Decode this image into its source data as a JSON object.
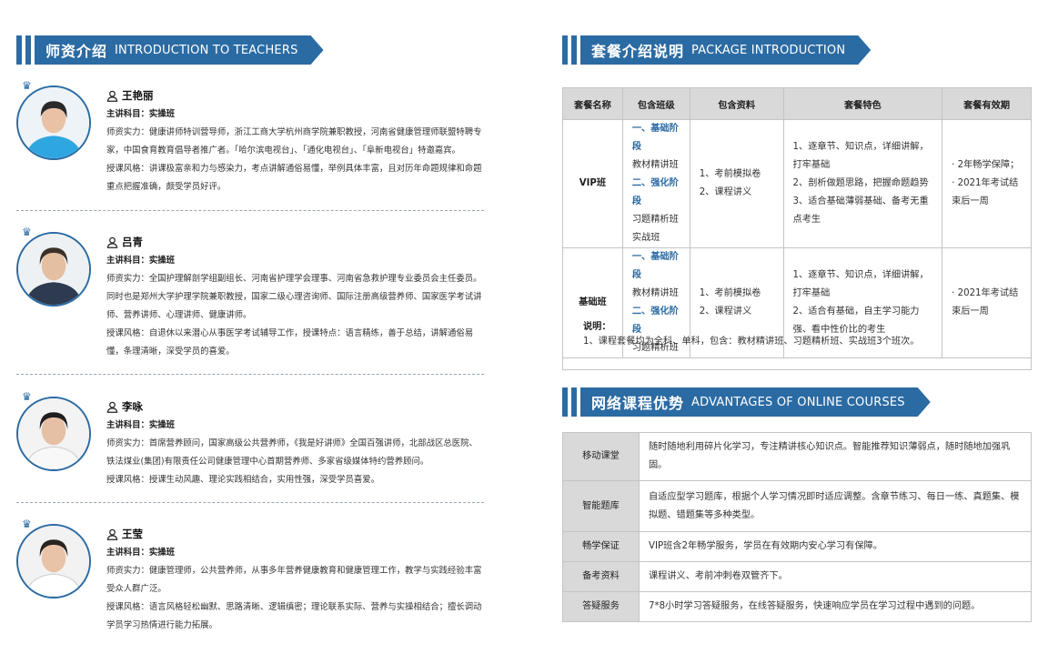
{
  "teachers_section": {
    "title_cn": "师资介绍",
    "title_en": "INTRODUCTION TO TEACHERS"
  },
  "teachers": [
    {
      "name": "王艳丽",
      "subject": "主讲科目：实操班",
      "strength_label": "师资实力：",
      "strength": "健康讲师特训营导师，浙江工商大学杭州商学院兼职教授，河南省健康管理师联盟特聘专家，中国食育教育倡导者推广者。「哈尔滨电视台」、「通化电视台」、「阜新电视台」特邀嘉宾。",
      "style_label": "授课风格：",
      "style": "讲课极富亲和力与感染力，考点讲解通俗易懂，举例具体丰富，且对历年命题规律和命题重点把握准确，颇受学员好评。"
    },
    {
      "name": "吕青",
      "subject": "主讲科目：实操班",
      "strength_label": "师资实力：",
      "strength": "全国护理解剖学组副组长、河南省护理学会理事、河南省急救护理专业委员会主任委员。同时也是郑州大学护理学院兼职教授，国家二级心理咨询师、国际注册高级营养师、国家医学考试讲师、营养讲师、心理讲师、健康讲师。",
      "style_label": "授课风格：",
      "style": "自退休以来潜心从事医学考试辅导工作，授课特点：语言精练，善于总结，讲解通俗易懂，条理清晰，深受学员的喜爱。"
    },
    {
      "name": "李咏",
      "subject": "主讲科目：实操班",
      "strength_label": "师资实力：",
      "strength": "首席营养顾问，国家高级公共营养师，《我是好讲师》全国百强讲师，北部战区总医院、铁法煤业(集团)有限责任公司健康管理中心首期营养师、多家省级媒体特约营养顾问。",
      "style_label": "授课风格：",
      "style": "授课生动风趣、理论实践相结合，实用性强，深受学员喜爱。"
    },
    {
      "name": "王莹",
      "subject": "主讲科目：实操班",
      "strength_label": "师资实力：",
      "strength": "健康管理师，公共营养师，从事多年营养健康教育和健康管理工作，教学与实践经验丰富受众人群广泛。",
      "style_label": "授课风格：",
      "style": "语言风格轻松幽默、思路清晰、逻辑缜密；理论联系实际、营养与实操相结合；擅长调动学员学习热情进行能力拓展。"
    }
  ],
  "package_section": {
    "title_cn": "套餐介绍说明",
    "title_en": "PACKAGE INTRODUCTION"
  },
  "package_table": {
    "headers": [
      "套餐名称",
      "包含班级",
      "包含资料",
      "套餐特色",
      "套餐有效期"
    ],
    "rows": [
      {
        "name": "VIP班",
        "classes": [
          "一、基础阶段",
          "教材精讲班",
          "二、强化阶段",
          "习题精析班",
          "实战班"
        ],
        "materials": [
          "1、考前模拟卷",
          "2、课程讲义"
        ],
        "features": [
          "1、逐章节、知识点，详细讲解，打牢基础",
          "2、剖析做题思路，把握命题趋势",
          "3、适合基础薄弱基础、备考无重点考生"
        ],
        "validity": [
          "· 2年畅学保障；",
          "· 2021年考试结束后一周"
        ]
      },
      {
        "name": "基础班",
        "classes": [
          "一、基础阶段",
          "教材精讲班",
          "二、强化阶段",
          "习题精析班"
        ],
        "materials": [
          "1、考前模拟卷",
          "2、课程讲义"
        ],
        "features": [
          "1、逐章节、知识点，详细讲解，打牢基础",
          "2、适合有基础，自主学习能力强、看中性价比的考生"
        ],
        "validity": [
          "· 2021年考试结束后一周"
        ]
      }
    ],
    "note_title": "说明：",
    "note": "1、课程套餐均为全科、单科，包含：教材精讲班、习题精析班、实战班3个班次。"
  },
  "advantages_section": {
    "title_cn": "网络课程优势",
    "title_en": "ADVANTAGES OF ONLINE COURSES"
  },
  "advantages": [
    {
      "key": "移动课堂",
      "value": "随时随地利用碎片化学习，专注精讲核心知识点。智能推荐知识薄弱点，随时随地加强巩固。"
    },
    {
      "key": "智能题库",
      "value": "自适应型学习题库，根据个人学习情况即时适应调整。含章节练习、每日一练、真题集、模拟题、错题集等多种类型。"
    },
    {
      "key": "畅学保证",
      "value": "VIP班含2年畅学服务，学员在有效期内安心学习有保障。"
    },
    {
      "key": "备考资料",
      "value": "课程讲义、考前冲刺卷双管齐下。"
    },
    {
      "key": "答疑服务",
      "value": "7*8小时学习答疑服务，在线答疑服务，快速响应学员在学习过程中遇到的问题。"
    }
  ],
  "colors": {
    "accent": "#2b6ba3",
    "header_gray": "#d9d9d9",
    "border": "#c4c4c4"
  }
}
